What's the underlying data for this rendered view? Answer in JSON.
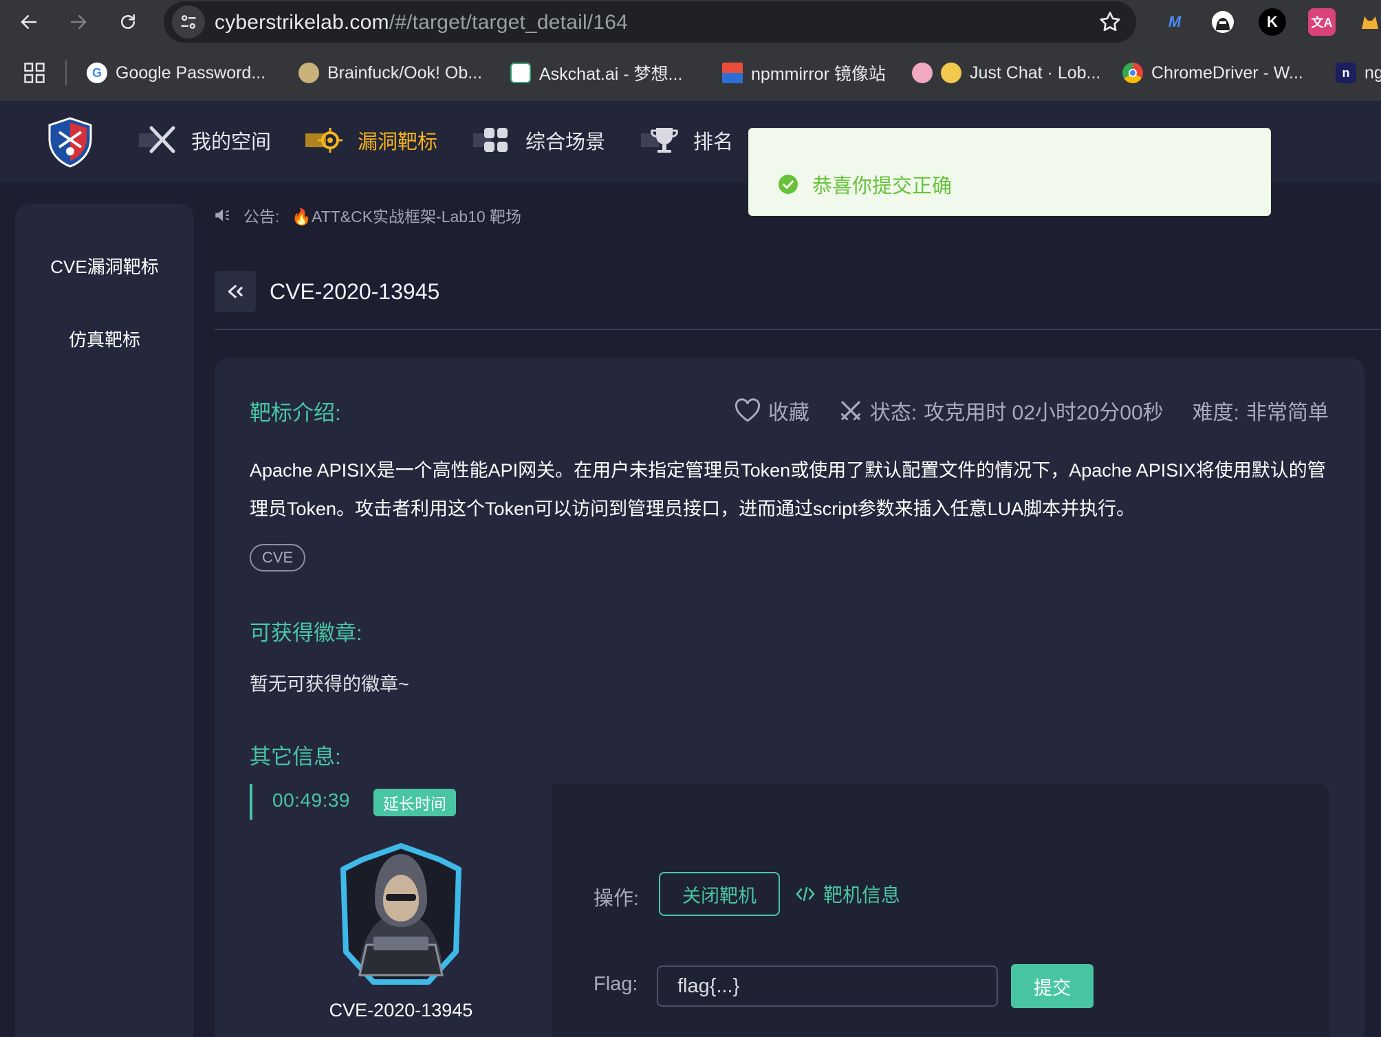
{
  "browser": {
    "url_host": "cyberstrikelab.com",
    "url_path": "/#/target/target_detail/164",
    "extensions": [
      {
        "icon": "m-extension-icon",
        "label": "M",
        "color": "#4d8cf5"
      },
      {
        "icon": "hacker-extension-icon",
        "label": "",
        "color": "#ffffff"
      },
      {
        "icon": "k-extension-icon",
        "label": "K",
        "color": "#000000"
      },
      {
        "icon": "translate-extension-icon",
        "label": "文A",
        "color": "#d9437a"
      },
      {
        "icon": "cat-extension-icon",
        "label": "",
        "color": "#f2b134"
      }
    ],
    "bookmarks": [
      {
        "label": "Google Password...",
        "icon": "google-password-icon"
      },
      {
        "label": "Brainfuck/Ook! Ob...",
        "icon": "brain-icon"
      },
      {
        "label": "Askchat.ai - 梦想...",
        "icon": "askchat-icon"
      },
      {
        "label": "npmmirror 镜像站",
        "icon": "npmmirror-icon"
      },
      {
        "label": "Just Chat · Lob...",
        "icon": "just-chat-icon"
      },
      {
        "label": "ChromeDriver - W...",
        "icon": "chrome-icon"
      },
      {
        "label": "ng",
        "icon": "n-icon"
      }
    ]
  },
  "header": {
    "nav": [
      {
        "label": "我的空间",
        "icon": "swords-icon",
        "active": false
      },
      {
        "label": "漏洞靶标",
        "icon": "target-icon",
        "active": true
      },
      {
        "label": "综合场景",
        "icon": "grid-icon",
        "active": false
      },
      {
        "label": "排名",
        "icon": "trophy-icon",
        "active": false
      }
    ]
  },
  "toast": {
    "message": "恭喜你提交正确",
    "type": "success"
  },
  "sidebar": {
    "items": [
      {
        "label": "CVE漏洞靶标"
      },
      {
        "label": "仿真靶标"
      }
    ]
  },
  "notice": {
    "prefix": "公告:",
    "text": "🔥ATT&CK实战框架-Lab10 靶场"
  },
  "page": {
    "title": "CVE-2020-13945"
  },
  "target": {
    "intro_title": "靶标介绍:",
    "favorite_label": "收藏",
    "status_label": "状态:",
    "status_value": "攻克用时 02小时20分00秒",
    "difficulty_label": "难度:",
    "difficulty_value": "非常简单",
    "description": "Apache APISIX是一个高性能API网关。在用户未指定管理员Token或使用了默认配置文件的情况下，Apache APISIX将使用默认的管理员Token。攻击者利用这个Token可以访问到管理员接口，进而通过script参数来插入任意LUA脚本并执行。",
    "tag": "CVE",
    "badges_title": "可获得徽章:",
    "badges_empty": "暂无可获得的徽章~",
    "other_title": "其它信息:"
  },
  "lab": {
    "timer": "00:49:39",
    "extend_label": "延长时间",
    "name": "CVE-2020-13945",
    "ops_label": "操作:",
    "close_label": "关闭靶机",
    "info_label": "靶机信息",
    "flag_label": "Flag:",
    "flag_placeholder": "flag{...}",
    "submit_label": "提交"
  },
  "colors": {
    "accent": "#48c6a4",
    "active_nav": "#f3b41d",
    "success": "#67c23a",
    "background": "#1d1f30",
    "panel": "#25283c"
  }
}
